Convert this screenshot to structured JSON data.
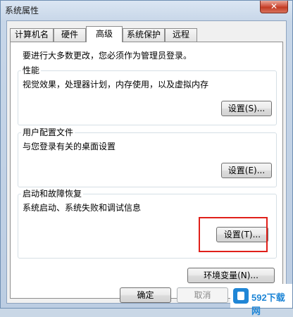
{
  "window": {
    "title": "系统属性",
    "close": "✕"
  },
  "tabs": [
    {
      "label": "计算机名",
      "active": false
    },
    {
      "label": "硬件",
      "active": false
    },
    {
      "label": "高级",
      "active": true
    },
    {
      "label": "系统保护",
      "active": false
    },
    {
      "label": "远程",
      "active": false
    }
  ],
  "notice": "要进行大多数更改，您必须作为管理员登录。",
  "groups": {
    "performance": {
      "label": "性能",
      "desc": "视觉效果，处理器计划，内存使用，以及虚拟内存",
      "button": "设置(S)..."
    },
    "profiles": {
      "label": "用户配置文件",
      "desc": "与您登录有关的桌面设置",
      "button": "设置(E)..."
    },
    "startup": {
      "label": "启动和故障恢复",
      "desc": "系统启动、系统失败和调试信息",
      "button": "设置(T)..."
    }
  },
  "env_button": "环境变量(N)...",
  "footer": {
    "ok": "确定",
    "cancel": "取消"
  },
  "watermark": {
    "text": "592下载网"
  },
  "colors": {
    "highlight": "#e0201a",
    "close_button": "#c23b23"
  }
}
